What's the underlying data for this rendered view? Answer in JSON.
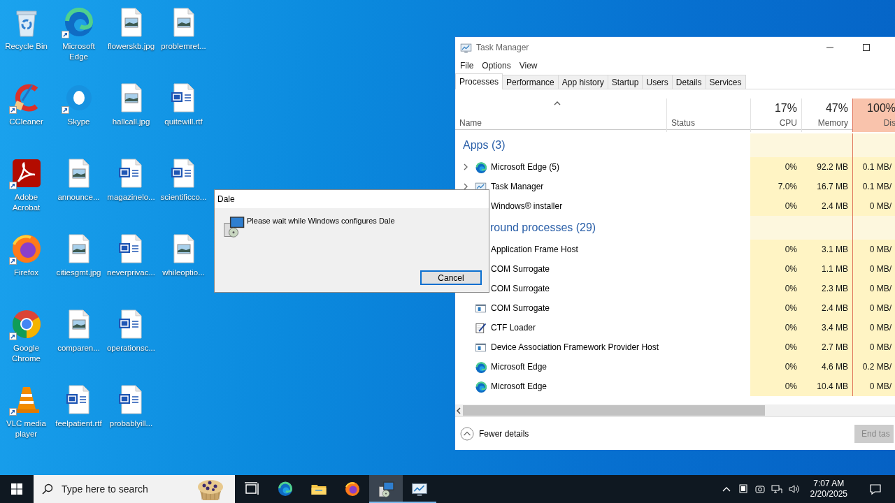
{
  "desktop_icons": [
    {
      "label": "Recycle Bin",
      "kind": "recycle",
      "shortcut": false
    },
    {
      "label": "CCleaner",
      "kind": "ccleaner",
      "shortcut": true
    },
    {
      "label": "Adobe Acrobat",
      "kind": "acrobat",
      "shortcut": true
    },
    {
      "label": "Firefox",
      "kind": "firefox",
      "shortcut": true
    },
    {
      "label": "Google Chrome",
      "kind": "chrome",
      "shortcut": true
    },
    {
      "label": "VLC media player",
      "kind": "vlc",
      "shortcut": true
    },
    {
      "label": "Microsoft Edge",
      "kind": "edge",
      "shortcut": true
    },
    {
      "label": "Skype",
      "kind": "skype",
      "shortcut": true
    },
    {
      "label": "announce...",
      "kind": "image",
      "shortcut": false
    },
    {
      "label": "citiesgmt.jpg",
      "kind": "image",
      "shortcut": false
    },
    {
      "label": "comparen...",
      "kind": "image",
      "shortcut": false
    },
    {
      "label": "feelpatient.rtf",
      "kind": "word",
      "shortcut": false
    },
    {
      "label": "flowerskb.jpg",
      "kind": "image",
      "shortcut": false
    },
    {
      "label": "hallcall.jpg",
      "kind": "image",
      "shortcut": false
    },
    {
      "label": "magazinelo...",
      "kind": "word",
      "shortcut": false
    },
    {
      "label": "neverprivac...",
      "kind": "word",
      "shortcut": false
    },
    {
      "label": "operationsc...",
      "kind": "word",
      "shortcut": false
    },
    {
      "label": "probablyill...",
      "kind": "word",
      "shortcut": false
    },
    {
      "label": "problemret...",
      "kind": "image",
      "shortcut": false
    },
    {
      "label": "quitewill.rtf",
      "kind": "word",
      "shortcut": false
    },
    {
      "label": "scientificco...",
      "kind": "word",
      "shortcut": false
    },
    {
      "label": "whileoptio...",
      "kind": "image",
      "shortcut": false
    }
  ],
  "task_manager": {
    "title": "Task Manager",
    "menu": [
      "File",
      "Options",
      "View"
    ],
    "tabs": [
      {
        "label": "Processes",
        "selected": true
      },
      {
        "label": "Performance",
        "selected": false
      },
      {
        "label": "App history",
        "selected": false
      },
      {
        "label": "Startup",
        "selected": false
      },
      {
        "label": "Users",
        "selected": false
      },
      {
        "label": "Details",
        "selected": false
      },
      {
        "label": "Services",
        "selected": false
      }
    ],
    "columns": {
      "name": "Name",
      "status": "Status",
      "metrics": [
        {
          "percent": "17%",
          "label": "CPU",
          "highlighted": false
        },
        {
          "percent": "47%",
          "label": "Memory",
          "highlighted": false
        },
        {
          "percent": "100%",
          "label": "Dis",
          "highlighted": true
        }
      ]
    },
    "groups": [
      {
        "label": "Apps (3)",
        "partly_hidden": false,
        "rows": [
          {
            "name": "Microsoft Edge (5)",
            "kind": "edge",
            "expandable": true,
            "values": [
              "0%",
              "92.2 MB",
              "0.1 MB/"
            ]
          },
          {
            "name": "Task Manager",
            "kind": "taskmgr",
            "expandable": true,
            "values": [
              "7.0%",
              "16.7 MB",
              "0.1 MB/"
            ]
          },
          {
            "name": "Windows® installer",
            "expandable": false,
            "values": [
              "0%",
              "2.4 MB",
              "0 MB/"
            ]
          }
        ]
      },
      {
        "label": "round processes (29)",
        "partly_hidden": true,
        "rows": [
          {
            "name": "Application Frame Host",
            "expandable": false,
            "values": [
              "0%",
              "3.1 MB",
              "0 MB/"
            ]
          },
          {
            "name": "COM Surrogate",
            "expandable": false,
            "values": [
              "0%",
              "1.1 MB",
              "0 MB/"
            ]
          },
          {
            "name": "COM Surrogate",
            "expandable": false,
            "values": [
              "0%",
              "2.3 MB",
              "0 MB/"
            ]
          },
          {
            "name": "COM Surrogate",
            "kind": "window",
            "expandable": false,
            "values": [
              "0%",
              "2.4 MB",
              "0 MB/"
            ]
          },
          {
            "name": "CTF Loader",
            "kind": "ctf",
            "expandable": false,
            "values": [
              "0%",
              "3.4 MB",
              "0 MB/"
            ]
          },
          {
            "name": "Device Association Framework Provider Host",
            "kind": "window",
            "expandable": false,
            "values": [
              "0%",
              "2.7 MB",
              "0 MB/"
            ]
          },
          {
            "name": "Microsoft Edge",
            "kind": "edge",
            "expandable": false,
            "values": [
              "0%",
              "4.6 MB",
              "0.2 MB/"
            ]
          },
          {
            "name": "Microsoft Edge",
            "kind": "edge",
            "expandable": false,
            "values": [
              "0%",
              "10.4 MB",
              "0 MB/"
            ]
          }
        ]
      }
    ],
    "footer": {
      "toggle": "Fewer details",
      "button": "End tas",
      "button_disabled": true
    }
  },
  "dialog": {
    "title": "Dale",
    "message": "Please wait while Windows configures Dale",
    "button": "Cancel"
  },
  "taskbar": {
    "search_placeholder": "Type here to search",
    "apps": [
      {
        "kind": "taskview",
        "active": false,
        "running": false
      },
      {
        "kind": "edge",
        "active": false,
        "running": false
      },
      {
        "kind": "explorer",
        "active": false,
        "running": false
      },
      {
        "kind": "firefox",
        "active": false,
        "running": false
      },
      {
        "kind": "installer",
        "active": true,
        "running": true
      },
      {
        "kind": "taskmgr",
        "active": false,
        "running": true
      }
    ],
    "time": "7:07 AM",
    "date": "2/20/2025"
  }
}
